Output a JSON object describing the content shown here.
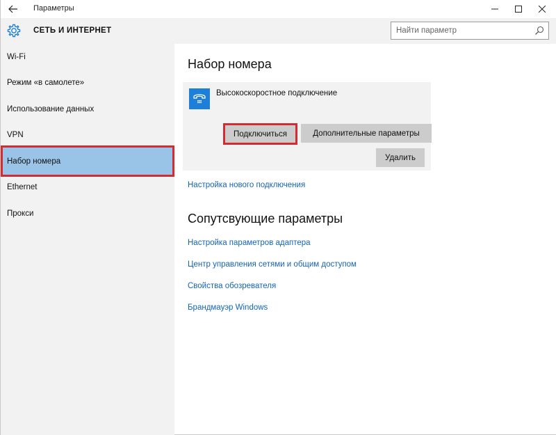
{
  "window": {
    "title": "Параметры",
    "controls": [
      "minimize",
      "maximize",
      "close"
    ]
  },
  "header": {
    "section_title": "СЕТЬ И ИНТЕРНЕТ",
    "search": {
      "placeholder": "Найти параметр",
      "value": ""
    }
  },
  "sidebar": {
    "items": [
      {
        "label": "Wi-Fi"
      },
      {
        "label": "Режим «в самолете»"
      },
      {
        "label": "Использование данных"
      },
      {
        "label": "VPN"
      },
      {
        "label": "Набор номера",
        "selected": true
      },
      {
        "label": "Ethernet"
      },
      {
        "label": "Прокси"
      }
    ]
  },
  "main": {
    "title": "Набор номера",
    "connection": {
      "name": "Высокоскоростное подключение",
      "icon": "dialup-phone-icon",
      "buttons": {
        "connect": "Подключиться",
        "advanced": "Дополнительные параметры",
        "delete": "Удалить"
      }
    },
    "new_connection_link": "Настройка нового подключения",
    "related_title": "Сопутсвующие параметры",
    "related_links": [
      "Настройка параметров адаптера",
      "Центр управления сетями и общим доступом",
      "Свойства обозревателя",
      "Брандмауэр Windows"
    ]
  },
  "colors": {
    "accent": "#1e7fd8",
    "selected_nav": "#99c4e8",
    "highlight_outline": "#d42a30",
    "link": "#1464b4",
    "sidebar_bg": "#f2f2f2"
  }
}
